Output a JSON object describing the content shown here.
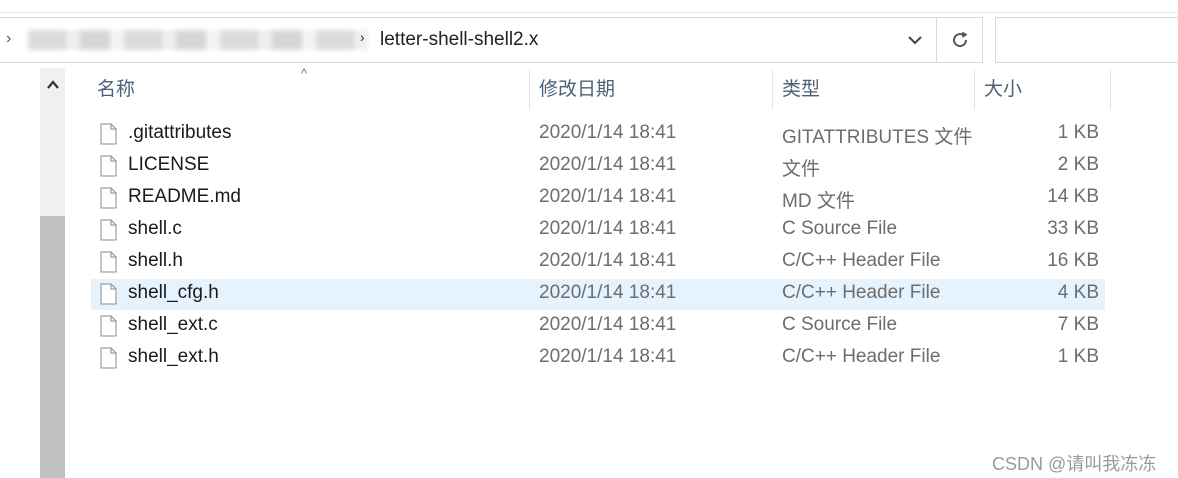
{
  "address_bar": {
    "current_folder": "letter-shell-shell2.x"
  },
  "columns": {
    "name": "名称",
    "date": "修改日期",
    "type": "类型",
    "size": "大小"
  },
  "files": [
    {
      "name": ".gitattributes",
      "date": "2020/1/14 18:41",
      "type": "GITATTRIBUTES 文件",
      "size": "1 KB",
      "selected": false
    },
    {
      "name": "LICENSE",
      "date": "2020/1/14 18:41",
      "type": "文件",
      "size": "2 KB",
      "selected": false
    },
    {
      "name": "README.md",
      "date": "2020/1/14 18:41",
      "type": "MD 文件",
      "size": "14 KB",
      "selected": false
    },
    {
      "name": "shell.c",
      "date": "2020/1/14 18:41",
      "type": "C Source File",
      "size": "33 KB",
      "selected": false
    },
    {
      "name": "shell.h",
      "date": "2020/1/14 18:41",
      "type": "C/C++ Header File",
      "size": "16 KB",
      "selected": false
    },
    {
      "name": "shell_cfg.h",
      "date": "2020/1/14 18:41",
      "type": "C/C++ Header File",
      "size": "4 KB",
      "selected": true
    },
    {
      "name": "shell_ext.c",
      "date": "2020/1/14 18:41",
      "type": "C Source File",
      "size": "7 KB",
      "selected": false
    },
    {
      "name": "shell_ext.h",
      "date": "2020/1/14 18:41",
      "type": "C/C++ Header File",
      "size": "1 KB",
      "selected": false
    }
  ],
  "icons": {
    "dropdown": "chevron-down-icon",
    "refresh": "refresh-icon",
    "file": "file-icon",
    "sort": "sort-ascending-icon",
    "scroll_up": "scroll-up-arrow-icon"
  },
  "colors": {
    "selected_row": "#e5f3ff",
    "header_text": "#4c607a",
    "scroll_thumb": "#c1c1c1"
  },
  "watermark": "CSDN @请叫我冻冻"
}
